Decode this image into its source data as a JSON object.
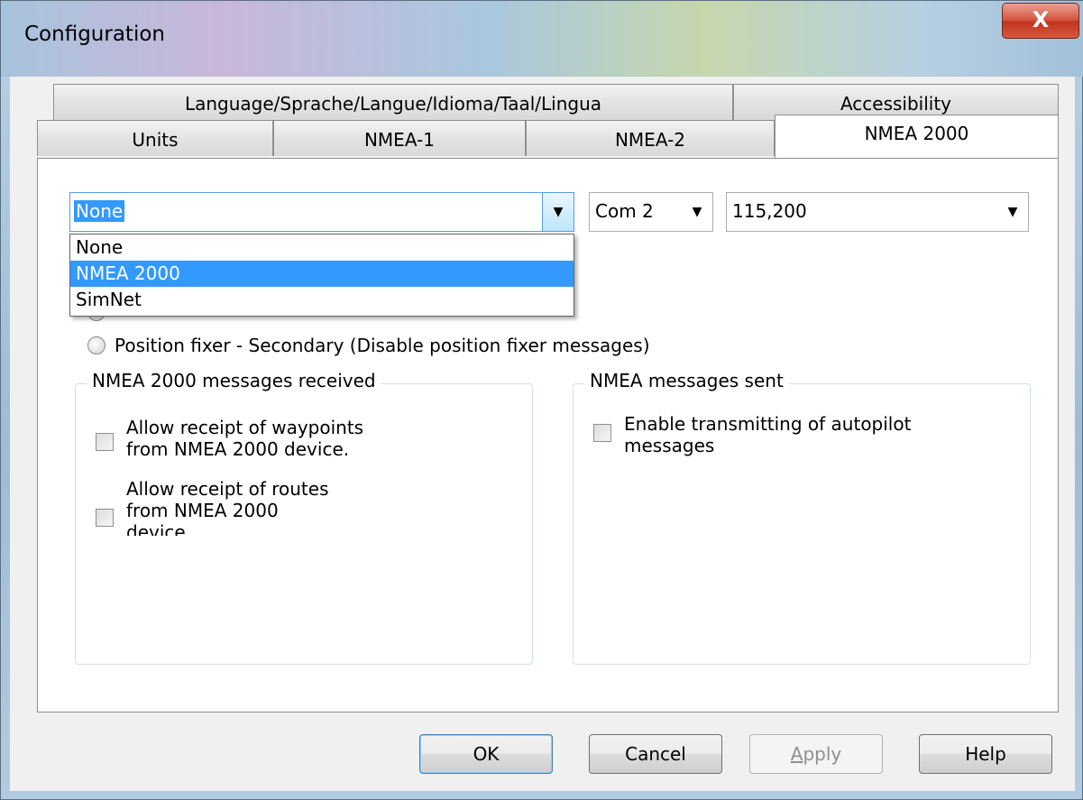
{
  "window": {
    "title": "Configuration",
    "close_glyph": "X"
  },
  "tabs": {
    "row1": [
      {
        "label": "Language/Sprache/Langue/Idioma/Taal/Lingua"
      },
      {
        "label": "Accessibility"
      }
    ],
    "row2": [
      {
        "label": "Units"
      },
      {
        "label": "NMEA-1"
      },
      {
        "label": "NMEA-2"
      },
      {
        "label": "NMEA 2000",
        "active": true
      }
    ]
  },
  "protocol_select": {
    "value": "None",
    "options": [
      "None",
      "NMEA 2000",
      "SimNet"
    ],
    "highlighted": "NMEA 2000"
  },
  "port_select": {
    "value": "Com 2"
  },
  "baud_select": {
    "value": "115,200"
  },
  "radio_secondary": {
    "label": "Position fixer - Secondary (Disable position fixer messages)"
  },
  "received_group": {
    "title": "NMEA 2000 messages received",
    "waypoints_label_1": "Allow receipt of waypoints",
    "waypoints_label_2": "from NMEA 2000 device.",
    "routes_label_1": "Allow receipt of routes",
    "routes_label_2": "from NMEA 2000",
    "routes_label_3": "device."
  },
  "sent_group": {
    "title": "NMEA messages sent",
    "autopilot_label_1": "Enable transmitting of autopilot",
    "autopilot_label_2": "messages"
  },
  "buttons": {
    "ok": "OK",
    "cancel": "Cancel",
    "apply_underlined": "A",
    "apply_rest": "pply",
    "help": "Help"
  }
}
